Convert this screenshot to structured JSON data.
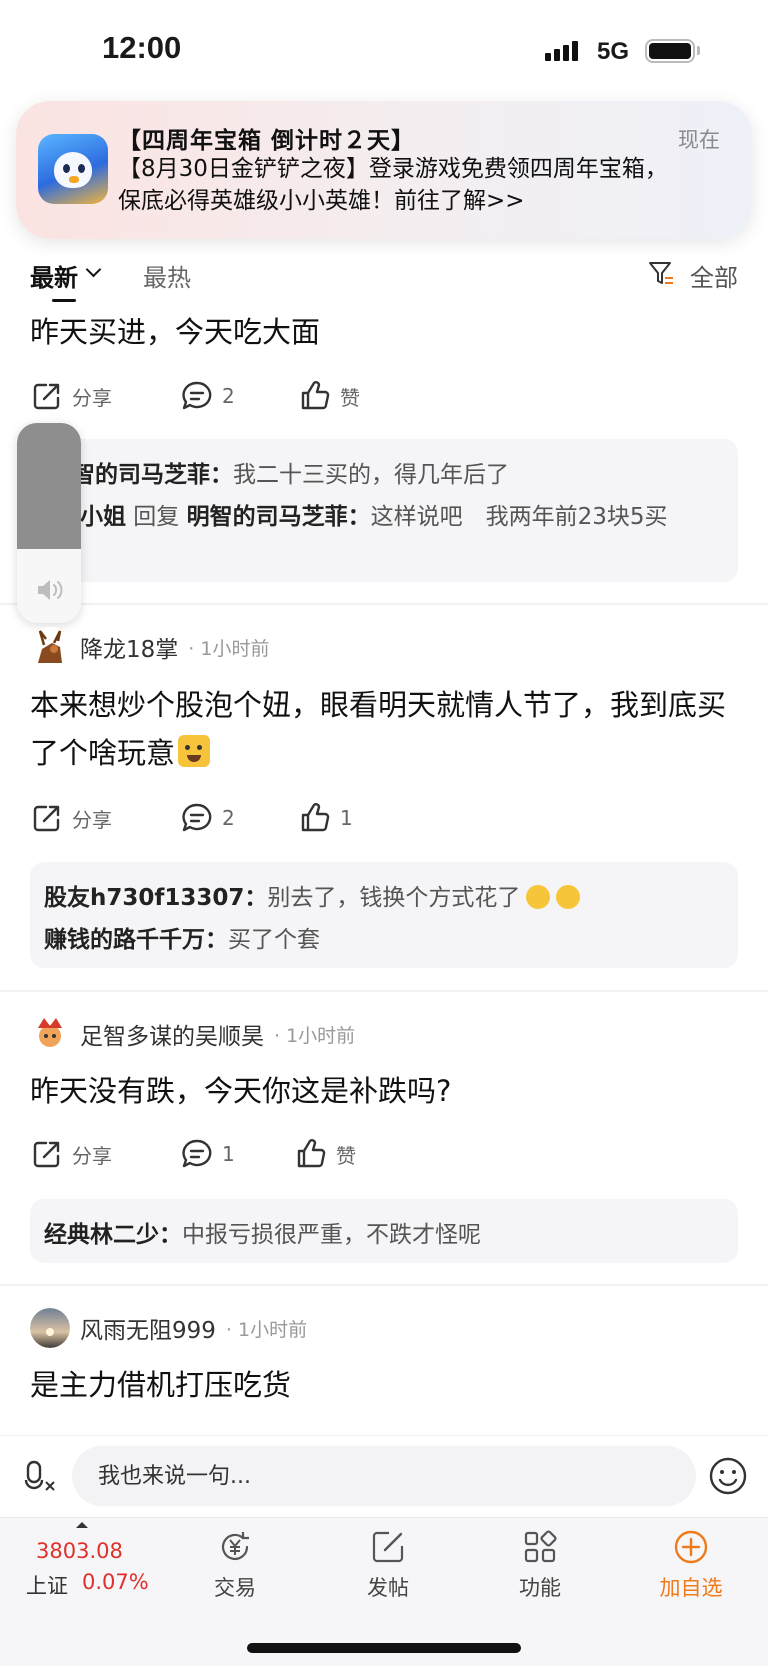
{
  "status_bar": {
    "time": "12:00",
    "network": "5G"
  },
  "notification": {
    "title": "【四周年宝箱 倒计时２天】",
    "time": "现在",
    "body": "【8月30日金铲铲之夜】登录游戏免费领四周年宝箱，保底必得英雄级小小英雄！前往了解>>"
  },
  "tabs": {
    "latest": "最新",
    "hot": "最热",
    "filter": "全部"
  },
  "posts": [
    {
      "text": "昨天买进，今天吃大面",
      "share": "分享",
      "comments": "2",
      "likes": "赞",
      "replies": [
        {
          "user": "智的司马芝菲：",
          "text": "我二十三买的，得几年后了"
        },
        {
          "user": "小姐",
          "mid": " 回复 ",
          "target": "明智的司马芝菲：",
          "text": "这样说吧　我两年前23块5买"
        }
      ]
    },
    {
      "author": "降龙18掌",
      "time": "· 1小时前",
      "text": "本来想炒个股泡个妞，眼看明天就情人节了，我到底买了个啥玩意",
      "share": "分享",
      "comments": "2",
      "likes": "1",
      "replies": [
        {
          "user": "股友h730f13307：",
          "text": "别去了，钱换个方式花了"
        },
        {
          "user": "赚钱的路千千万：",
          "text": "买了个套"
        }
      ]
    },
    {
      "author": "足智多谋的吴顺昊",
      "time": "· 1小时前",
      "text": "昨天没有跌，今天你这是补跌吗?",
      "share": "分享",
      "comments": "1",
      "likes": "赞",
      "replies": [
        {
          "user": "经典林二少：",
          "text": "中报亏损很严重，不跌才怪呢"
        }
      ]
    },
    {
      "author": "风雨无阻999",
      "time": "· 1小时前",
      "text": "是主力借机打压吃货"
    }
  ],
  "input": {
    "placeholder": "我也来说一句..."
  },
  "bottom_nav": {
    "index_value": "3803.08",
    "index_name": "上证",
    "index_change": "0.07%",
    "items": [
      "交易",
      "发帖",
      "功能",
      "加自选"
    ]
  },
  "colors": {
    "up_red": "#e0302b",
    "accent_orange": "#ef7a1a"
  }
}
